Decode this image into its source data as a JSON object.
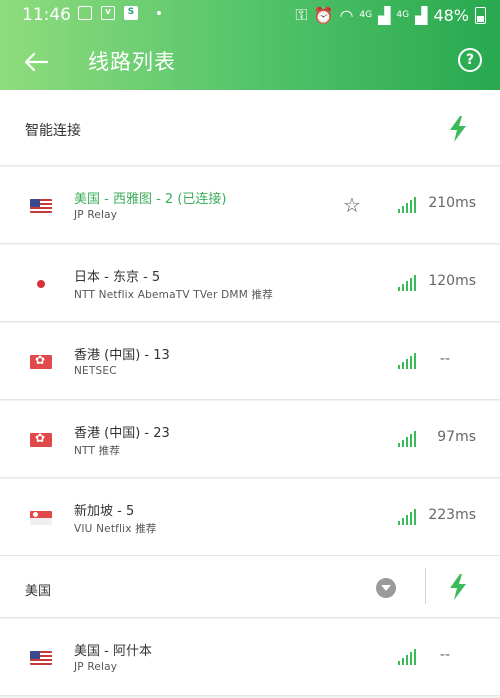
{
  "statusbar": {
    "time": "11:46",
    "icons": [
      "image-icon",
      "vk-icon",
      "s-app-icon",
      "dot"
    ],
    "network_labels": [
      "4G",
      "4G"
    ],
    "battery": "48%"
  },
  "header": {
    "title": "线路列表"
  },
  "smart_connect": {
    "label": "智能连接"
  },
  "servers": [
    {
      "name": "美国 - 西雅图 - 2 (已连接)",
      "tags": "JP Relay",
      "flag": "us",
      "latency": "210ms",
      "connected": true,
      "starred": false
    },
    {
      "name": "日本 - 东京 - 5",
      "tags": "NTT  Netflix  AbemaTV  TVer  DMM  推荐",
      "flag": "jp",
      "latency": "120ms",
      "connected": false
    },
    {
      "name": "香港 (中国) - 13",
      "tags": "NETSEC",
      "flag": "hk",
      "latency": "--",
      "connected": false
    },
    {
      "name": "香港 (中国) - 23",
      "tags": "NTT  推荐",
      "flag": "hk",
      "latency": "97ms",
      "connected": false
    },
    {
      "name": "新加坡 - 5",
      "tags": "VIU  Netflix  推荐",
      "flag": "sg",
      "latency": "223ms",
      "connected": false
    }
  ],
  "section_us": {
    "label": "美国",
    "servers": [
      {
        "name": "美国 - 阿什本",
        "tags": "JP Relay",
        "flag": "us",
        "latency": "--"
      }
    ]
  },
  "colors": {
    "accent_green": "#3cbb5c",
    "connected_text": "#3cae5c",
    "header_gradient": [
      "#8fdc7e",
      "#27a84f"
    ]
  }
}
